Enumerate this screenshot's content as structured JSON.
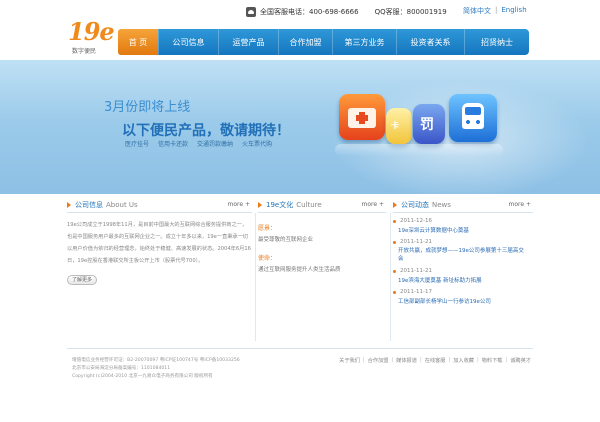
{
  "logo": {
    "mark": "19e",
    "text": "数字便民"
  },
  "top_bar": {
    "hotline": "全国客服电话：400-698-6666",
    "qq": "QQ客服：800001919",
    "lang_cn": "简体中文",
    "lang_sep": "|",
    "lang_en": "English"
  },
  "nav": {
    "items": [
      {
        "label": "首 页"
      },
      {
        "label": "公司信息"
      },
      {
        "label": "运营产品"
      },
      {
        "label": "合作加盟"
      },
      {
        "label": "第三方业务"
      },
      {
        "label": "投资者关系"
      },
      {
        "label": "招贤纳士"
      }
    ]
  },
  "banner": {
    "title1": "3月份即将上线",
    "title2": "以下便民产品，敬请期待！",
    "subs": [
      "医疗挂号",
      "信用卡还款",
      "交通罚款缴纳",
      "火车票代购"
    ],
    "icon_card_text": "卡",
    "icon_fine_text": "罚"
  },
  "about": {
    "title": "公司信息",
    "en": "About Us",
    "more": "more",
    "text": "19e公司成立于1998年11月，是目前中国最大的互联网综合服务提供商之一，也是中国服务用户最多的互联网企业之一。成立十年多以来，19e一直秉承一切以用户价值为依归的经营理念，始终处于稳健、高速发展的状态。2004年6月16日，19e控股在香港联交所主板公开上市（股票代号700）。",
    "button": "了解更多"
  },
  "culture": {
    "title": "19e文化",
    "en": "Culture",
    "more": "more",
    "items": [
      {
        "label": "愿景：",
        "text": "最受尊敬的互联网企业"
      },
      {
        "label": "使命：",
        "text": "通过互联网服务提升人类生活品质"
      }
    ]
  },
  "news": {
    "title": "公司动态",
    "en": "News",
    "more": "more",
    "items": [
      {
        "date": "2011-12-16",
        "title": "19e深圳云计算数据中心奠基"
      },
      {
        "date": "2011-11-21",
        "title": "开放共赢，成就梦想——19e公司参展第十三届高交会"
      },
      {
        "date": "2011-11-21",
        "title": "19e滨海大厦奠基 新址标助力拓展"
      },
      {
        "date": "2011-11-17",
        "title": "工信部副部长杨学山一行参访19e公司"
      }
    ]
  },
  "footer": {
    "lines": [
      "增值电信业务经营许可证：B2-20070097 粤ICP证100747号 粤ICP备10033256",
      "北京市公安局海淀分局备案编号：1101084011",
      "Copyright (c)2004-2010 北京一九易众电子商务有限公司 版权所有"
    ],
    "links": [
      "关于我们",
      "合作加盟",
      "媒体报道",
      "在线客服",
      "加入收藏",
      "物料下载",
      "诚聘英才"
    ]
  }
}
